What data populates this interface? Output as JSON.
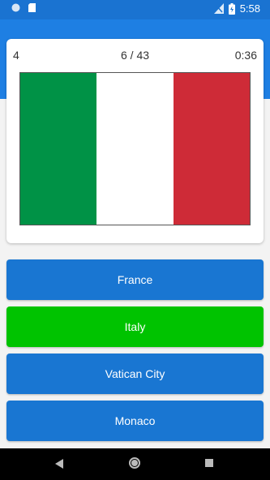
{
  "status_bar": {
    "time": "5:58",
    "icons": [
      "sync-icon",
      "sd-card-icon",
      "no-signal-icon",
      "battery-charging-icon"
    ]
  },
  "quiz": {
    "score": "4",
    "progress": "6 / 43",
    "timer": "0:36",
    "flag_colors": [
      "#009246",
      "#ffffff",
      "#ce2b37"
    ]
  },
  "answers": [
    {
      "label": "France",
      "color": "#1976d2"
    },
    {
      "label": "Italy",
      "color": "#00c300"
    },
    {
      "label": "Vatican City",
      "color": "#1976d2"
    },
    {
      "label": "Monaco",
      "color": "#1976d2"
    }
  ],
  "nav": {
    "icons": [
      "back-icon",
      "home-icon",
      "recent-apps-icon"
    ]
  }
}
